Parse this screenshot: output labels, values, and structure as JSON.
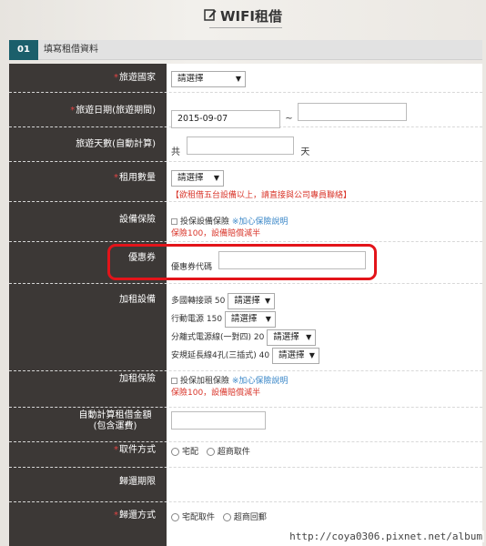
{
  "header": {
    "title": "WIFI租借",
    "icon": "edit-icon"
  },
  "section": {
    "number": "01",
    "title": "填寫租借資料"
  },
  "rows": {
    "country": {
      "label": "旅遊國家",
      "select": "請選擇"
    },
    "dates": {
      "label": "旅遊日期(旅遊期間)",
      "start": "2015-09-07",
      "separator": "~",
      "end": ""
    },
    "days": {
      "label": "旅遊天數(自動計算)",
      "prefix": "共",
      "value": "",
      "suffix": "天"
    },
    "qty": {
      "label": "租用數量",
      "select": "請選擇",
      "note": "【欲租借五台設備以上，請直接與公司專員聯絡】"
    },
    "insurance": {
      "label": "設備保險",
      "option": "投保設備保險",
      "link": "※加心保險說明",
      "note": "保險100，設備賠償減半"
    },
    "coupon": {
      "label": "優惠券",
      "field_label": "優惠券代碼",
      "value": ""
    },
    "addons": {
      "label": "加租設備",
      "items": [
        {
          "name": "多國轉接頭 50",
          "select": "請選擇"
        },
        {
          "name": "行動電源 150",
          "select": "請選擇"
        },
        {
          "name": "分離式電源線(一對四) 20",
          "select": "請選擇"
        },
        {
          "name": "安規延長線4孔(三插式) 40",
          "select": "請選擇"
        }
      ]
    },
    "addon_insurance": {
      "label": "加租保險",
      "option": "投保加租保險",
      "link": "※加心保險說明",
      "note": "保險100，設備賠償減半"
    },
    "total": {
      "label_line1": "自動計算租借金額",
      "label_line2": "(包含運費)",
      "value": ""
    },
    "pickup": {
      "label": "取件方式",
      "options": [
        "宅配",
        "超商取件"
      ]
    },
    "return_period": {
      "label": "歸還期限"
    },
    "return_method": {
      "label": "歸還方式",
      "options": [
        "宅配取件",
        "超商回郵"
      ]
    }
  },
  "watermark": "http://coya0306.pixnet.net/album",
  "colors": {
    "accent": "#1b5f6b",
    "label_bg": "#3c3836",
    "alert": "#d9362b",
    "link": "#3a87c8",
    "highlight": "#e3141a"
  }
}
